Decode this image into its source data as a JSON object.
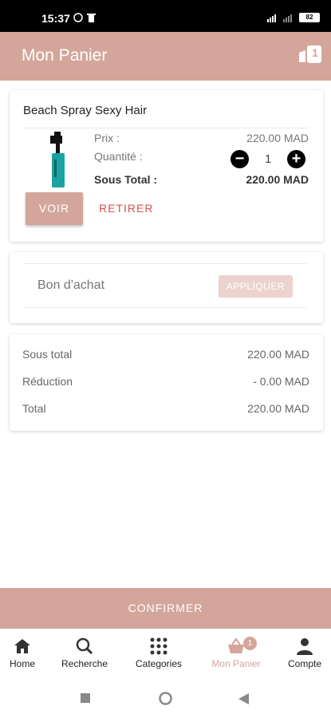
{
  "status_bar": {
    "time": "15:37",
    "battery": "82"
  },
  "header": {
    "title": "Mon Panier",
    "cart_count": "1"
  },
  "product": {
    "name": "Beach Spray Sexy Hair",
    "price_label": "Prix :",
    "price_value": "220.00 MAD",
    "quantity_label": "Quantité :",
    "quantity_value": "1",
    "subtotal_label": "Sous Total :",
    "subtotal_value": "220.00 MAD",
    "view_button": "VOIR",
    "remove_button": "RETIRER"
  },
  "coupon": {
    "placeholder": "Bon d'achat",
    "apply_button": "APPLIQUER"
  },
  "summary": {
    "rows": [
      {
        "label": "Sous total",
        "value": "220.00 MAD"
      },
      {
        "label": "Réduction",
        "value": "- 0.00 MAD"
      },
      {
        "label": "Total",
        "value": "220.00 MAD"
      }
    ]
  },
  "confirm_button": "CONFIRMER",
  "bottom_nav": {
    "items": [
      {
        "label": "Home",
        "icon": "home-icon"
      },
      {
        "label": "Recherche",
        "icon": "search-icon"
      },
      {
        "label": "Categories",
        "icon": "grid-icon"
      },
      {
        "label": "Mon Panier",
        "icon": "basket-icon",
        "badge": "1"
      },
      {
        "label": "Compte",
        "icon": "person-icon"
      }
    ]
  },
  "colors": {
    "brand": "#d4a69b",
    "danger": "#d9534f",
    "apply_disabled": "#ecd3cd"
  }
}
